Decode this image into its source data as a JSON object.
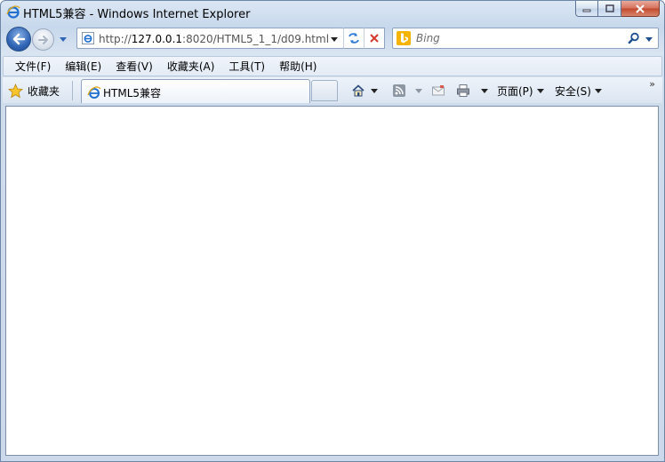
{
  "window": {
    "title": "HTML5兼容 - Windows Internet Explorer",
    "icons": {
      "app": "ie-logo-icon",
      "minimize": "minimize-icon",
      "maximize": "maximize-icon",
      "close": "close-icon"
    }
  },
  "nav": {
    "address_url": "http://127.0.0.1:8020/HTML5_1_1/d09.html",
    "address_prefix": "http://",
    "address_host": "127.0.0.1",
    "address_rest": ":8020/HTML5_1_1/d09.html",
    "search_placeholder": "Bing",
    "icons": {
      "back": "back-arrow-icon",
      "forward": "forward-arrow-icon",
      "refresh": "refresh-icon",
      "stop": "stop-icon",
      "search": "search-icon",
      "bing": "bing-logo-icon"
    }
  },
  "menu": {
    "items": [
      "文件(F)",
      "编辑(E)",
      "查看(V)",
      "收藏夹(A)",
      "工具(T)",
      "帮助(H)"
    ]
  },
  "favorites": {
    "label": "收藏夹",
    "tab_label": "HTML5兼容",
    "commands": {
      "page": "页面(P)",
      "safety": "安全(S)",
      "more": "»"
    },
    "icons": {
      "star": "star-icon",
      "home": "home-icon",
      "feeds": "rss-feed-icon",
      "mail": "mail-icon",
      "print": "print-icon"
    }
  },
  "colors": {
    "frame": "#cbd9eb",
    "close_button": "#c2482c",
    "back_button": "#2f64b5",
    "ie_blue": "#1f6fd1",
    "bing_yellow": "#f4b400"
  }
}
